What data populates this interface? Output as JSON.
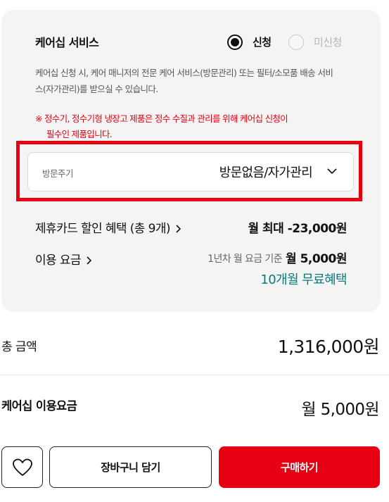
{
  "care_service": {
    "title": "케어십 서비스",
    "option_apply": "신청",
    "option_not_apply": "미신청",
    "selected": "신청",
    "description": "케어십 신청 시, 케어 매니저의 전문 케어 서비스(방문관리) 또는 필터/소모품 배송 서비스(자가관리)를 받으실 수 있습니다.",
    "notice_line1": "※ 정수기, 정수기형 냉장고 제품은 정수 수질과 관리를 위해 케어십 신청이",
    "notice_line2": "필수인 제품입니다.",
    "visit_cycle_label": "방문주기",
    "visit_cycle_value": "방문없음/자가관리"
  },
  "card_discount": {
    "label": "제휴카드 할인 혜택 (총 9개)",
    "value": "월 최대 -23,000원"
  },
  "usage_fee": {
    "label": "이용 요금",
    "basis": "1년차 월 요금 기준",
    "value": "월 5,000원",
    "benefit": "10개월 무료혜택"
  },
  "summary": {
    "total_label": "총 금액",
    "total_value": "1,316,000원",
    "care_fee_label": "케어십 이용요금",
    "care_fee_value": "월 5,000원"
  },
  "actions": {
    "wish_icon": "heart-icon",
    "cart_label": "장바구니 담기",
    "buy_label": "구매하기"
  },
  "colors": {
    "accent_red": "#e60012",
    "benefit_teal": "#0b7a7a",
    "panel_bg": "#f4f4f4"
  }
}
